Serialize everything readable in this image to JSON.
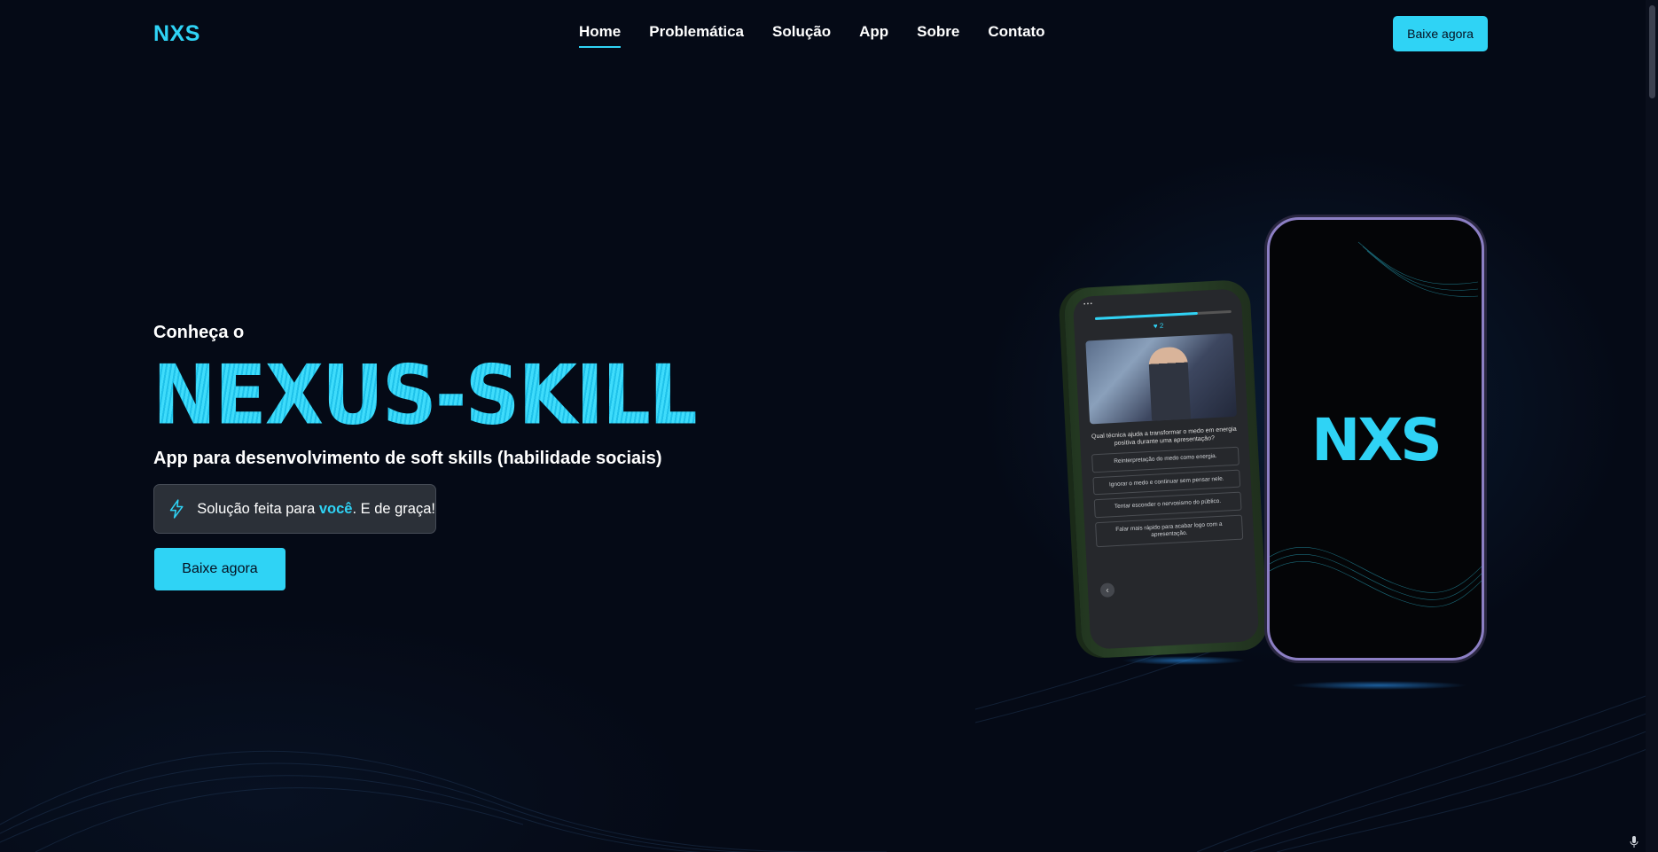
{
  "header": {
    "logo": "NXS",
    "nav": [
      {
        "label": "Home",
        "active": true
      },
      {
        "label": "Problemática"
      },
      {
        "label": "Solução"
      },
      {
        "label": "App"
      },
      {
        "label": "Sobre"
      },
      {
        "label": "Contato"
      }
    ],
    "cta_label": "Baixe agora"
  },
  "hero": {
    "kicker": "Conheça o",
    "title": "NEXUS-SKILL",
    "subtitle": "App para desenvolvimento de soft skills (habilidade sociais)",
    "badge": {
      "icon": "lightning-icon",
      "text_before": "Solução feita para ",
      "highlight": "você",
      "text_after": ". E de graça!"
    },
    "cta_label": "Baixe agora"
  },
  "app_preview": {
    "lives": "2",
    "progress": 0.75,
    "question": "Qual técnica ajuda a transformar o medo em energia positiva durante uma apresentação?",
    "options": [
      "Reinterpretação do medo como energia.",
      "Ignorar o medo e continuar sem pensar nele.",
      "Tentar esconder o nervosismo do público.",
      "Falar mais rápido para acabar logo com a apresentação."
    ],
    "splash_logo": "NXS"
  },
  "colors": {
    "accent": "#2fd3f5",
    "background": "#050a16",
    "badge_bg": "#2b3038"
  }
}
